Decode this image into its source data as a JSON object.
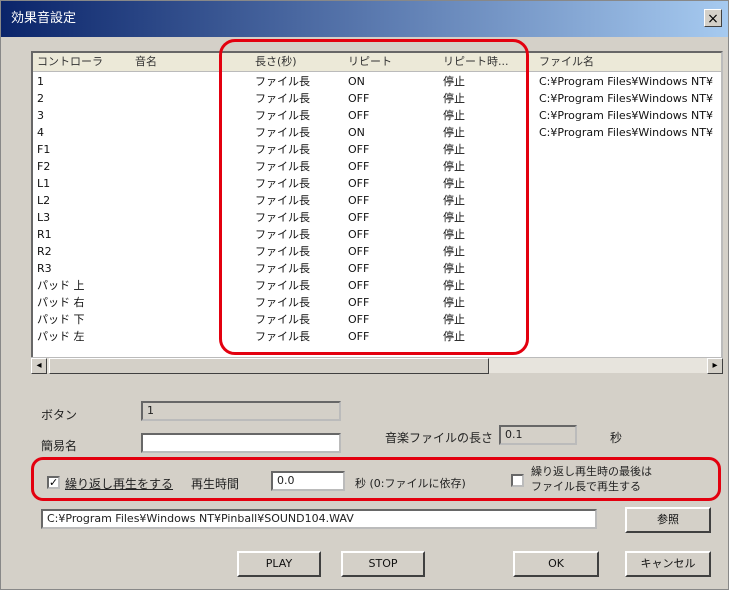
{
  "window": {
    "title": "効果音設定",
    "close_label": "×"
  },
  "list": {
    "columns": [
      "コントローラ",
      "音名",
      "長さ(秒)",
      "リピート",
      "リピート時...",
      "ファイル名"
    ],
    "rows": [
      [
        "1",
        "",
        "ファイル長",
        "ON",
        "停止",
        "C:¥Program Files¥Windows NT¥"
      ],
      [
        "2",
        "",
        "ファイル長",
        "OFF",
        "停止",
        "C:¥Program Files¥Windows NT¥"
      ],
      [
        "3",
        "",
        "ファイル長",
        "OFF",
        "停止",
        "C:¥Program Files¥Windows NT¥"
      ],
      [
        "4",
        "",
        "ファイル長",
        "ON",
        "停止",
        "C:¥Program Files¥Windows NT¥"
      ],
      [
        "F1",
        "",
        "ファイル長",
        "OFF",
        "停止",
        ""
      ],
      [
        "F2",
        "",
        "ファイル長",
        "OFF",
        "停止",
        ""
      ],
      [
        "L1",
        "",
        "ファイル長",
        "OFF",
        "停止",
        ""
      ],
      [
        "L2",
        "",
        "ファイル長",
        "OFF",
        "停止",
        ""
      ],
      [
        "L3",
        "",
        "ファイル長",
        "OFF",
        "停止",
        ""
      ],
      [
        "R1",
        "",
        "ファイル長",
        "OFF",
        "停止",
        ""
      ],
      [
        "R2",
        "",
        "ファイル長",
        "OFF",
        "停止",
        ""
      ],
      [
        "R3",
        "",
        "ファイル長",
        "OFF",
        "停止",
        ""
      ],
      [
        "パッド 上",
        "",
        "ファイル長",
        "OFF",
        "停止",
        ""
      ],
      [
        "パッド 右",
        "",
        "ファイル長",
        "OFF",
        "停止",
        ""
      ],
      [
        "パッド 下",
        "",
        "ファイル長",
        "OFF",
        "停止",
        ""
      ],
      [
        "パッド 左",
        "",
        "ファイル長",
        "OFF",
        "停止",
        ""
      ]
    ]
  },
  "scroll": {
    "left_arrow": "◂",
    "right_arrow": "▸"
  },
  "form": {
    "button_label": "ボタン",
    "button_value": "1",
    "name_label": "簡易名",
    "name_value": "",
    "sound_length_label": "音楽ファイルの長さ",
    "sound_length_value": "0.1",
    "sound_length_unit": "秒",
    "repeat_checkbox_label": "繰り返し再生をする",
    "repeat_checked": "✓",
    "play_time_label": "再生時間",
    "play_time_value": "0.0",
    "play_time_unit": "秒 (0:ファイルに依存)",
    "interrupt_checkbox_label_line1": "繰り返し再生時の最後は",
    "interrupt_checkbox_label_line2": "ファイル長で再生する",
    "file_path": "C:¥Program Files¥Windows NT¥Pinball¥SOUND104.WAV",
    "browse_label": "参照"
  },
  "buttons": {
    "play": "PLAY",
    "stop": "STOP",
    "ok": "OK",
    "cancel": "キャンセル"
  },
  "colors": {
    "highlight": "#e3000f",
    "titlebar": "#0a246a"
  }
}
